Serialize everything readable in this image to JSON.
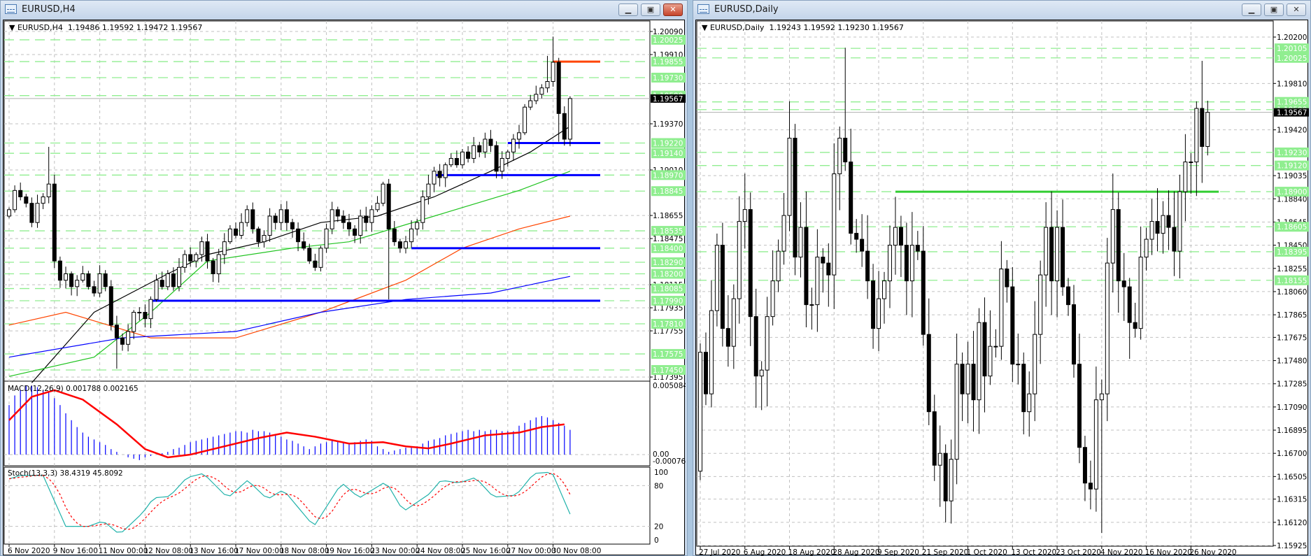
{
  "colors": {
    "bull": "#ffffff",
    "bear": "#000000",
    "grid": "#c0c0c0",
    "level": "#90ee90",
    "ma_black": "#000000",
    "ma_green": "#1fc31f",
    "ma_red": "#ff4500",
    "ma_blue": "#0000ff",
    "hline_red": "#ff4500",
    "hline_blue": "#0000ff",
    "hline_green": "#32cd32",
    "macd_hist": "#0000ff",
    "macd_signal": "#ff0000",
    "stoch_main": "#20b2aa",
    "stoch_signal": "#ff0000"
  },
  "windows": [
    {
      "title": "EURUSD,H4",
      "symbol": "EURUSD,H4",
      "ohlc": "1.19486 1.19592 1.19472 1.19567",
      "buttons": {
        "minimize": "▁",
        "restore": "▣",
        "close": "✕"
      }
    },
    {
      "title": "EURUSD,Daily",
      "symbol": "EURUSD,Daily",
      "ohlc": "1.19243 1.19592 1.19230 1.19567",
      "buttons": {
        "minimize": "▁",
        "restore": "▣",
        "close": "✕"
      }
    }
  ],
  "h4": {
    "current_price": "1.19567",
    "price_ticks": [
      "1.20090",
      "1.19910",
      "1.19370",
      "1.19010",
      "1.18655",
      "1.18475",
      "1.18115",
      "1.17935",
      "1.17755",
      "1.17395"
    ],
    "levels": [
      "1.20025",
      "1.19855",
      "1.19730",
      "1.19590",
      "1.19220",
      "1.19140",
      "1.18970",
      "1.18845",
      "1.18535",
      "1.18400",
      "1.18290",
      "1.18200",
      "1.18085",
      "1.17990",
      "1.17810",
      "1.17575",
      "1.17450"
    ],
    "time_labels": [
      "6 Nov 2020",
      "9 Nov 16:00",
      "11 Nov 00:00",
      "12 Nov 08:00",
      "13 Nov 16:00",
      "17 Nov 00:00",
      "18 Nov 08:00",
      "19 Nov 16:00",
      "23 Nov 00:00",
      "24 Nov 08:00",
      "25 Nov 16:00",
      "27 Nov 00:00",
      "30 Nov 08:00"
    ],
    "open0": 1.1865,
    "closes": [
      1.187,
      1.1885,
      1.188,
      1.1875,
      1.186,
      1.1875,
      1.188,
      1.189,
      1.183,
      1.1815,
      1.182,
      1.181,
      1.1815,
      1.182,
      1.181,
      1.1805,
      1.182,
      1.181,
      1.178,
      1.177,
      1.1765,
      1.1775,
      1.179,
      1.179,
      1.1785,
      1.18,
      1.1815,
      1.181,
      1.182,
      1.181,
      1.1825,
      1.1835,
      1.183,
      1.1835,
      1.1845,
      1.183,
      1.182,
      1.1835,
      1.1845,
      1.1855,
      1.185,
      1.186,
      1.187,
      1.1855,
      1.1845,
      1.185,
      1.1865,
      1.186,
      1.187,
      1.186,
      1.1855,
      1.1845,
      1.184,
      1.183,
      1.1825,
      1.184,
      1.1855,
      1.187,
      1.1865,
      1.186,
      1.1855,
      1.185,
      1.1865,
      1.186,
      1.187,
      1.1875,
      1.189,
      1.1855,
      1.1845,
      1.184,
      1.1845,
      1.1855,
      1.186,
      1.188,
      1.189,
      1.19,
      1.1895,
      1.1905,
      1.191,
      1.1905,
      1.1915,
      1.191,
      1.192,
      1.1915,
      1.1925,
      1.192,
      1.19,
      1.191,
      1.1915,
      1.1925,
      1.193,
      1.195,
      1.1955,
      1.196,
      1.1965,
      1.197,
      1.1985,
      1.1945,
      1.1925,
      1.19567
    ],
    "high_overrides": {
      "7": 1.1919,
      "96": 1.2005,
      "95": 1.199
    },
    "low_overrides": {
      "19": 1.1746,
      "67": 1.18,
      "97": 1.1923
    },
    "ma": {
      "black": [
        [
          4,
          1.1735
        ],
        [
          15,
          1.179
        ],
        [
          28,
          1.182
        ],
        [
          35,
          1.1835
        ],
        [
          45,
          1.1845
        ],
        [
          55,
          1.186
        ],
        [
          65,
          1.1865
        ],
        [
          75,
          1.188
        ],
        [
          85,
          1.19
        ],
        [
          92,
          1.1915
        ],
        [
          99,
          1.1935
        ]
      ],
      "green": [
        [
          0,
          1.174
        ],
        [
          15,
          1.1755
        ],
        [
          25,
          1.179
        ],
        [
          35,
          1.183
        ],
        [
          50,
          1.184
        ],
        [
          60,
          1.1845
        ],
        [
          75,
          1.1865
        ],
        [
          90,
          1.1885
        ],
        [
          99,
          1.19
        ]
      ],
      "red": [
        [
          0,
          1.178
        ],
        [
          10,
          1.179
        ],
        [
          25,
          1.177
        ],
        [
          40,
          1.177
        ],
        [
          55,
          1.179
        ],
        [
          70,
          1.1815
        ],
        [
          80,
          1.184
        ],
        [
          90,
          1.1855
        ],
        [
          99,
          1.1865
        ]
      ],
      "blue": [
        [
          0,
          1.1755
        ],
        [
          20,
          1.177
        ],
        [
          40,
          1.1775
        ],
        [
          55,
          1.179
        ],
        [
          70,
          1.18
        ],
        [
          85,
          1.1805
        ],
        [
          99,
          1.1818
        ]
      ]
    },
    "hlines": [
      {
        "color": "hline_red",
        "price": 1.19855,
        "from": 96
      },
      {
        "color": "hline_blue",
        "price": 1.1922,
        "from": 88
      },
      {
        "color": "hline_blue",
        "price": 1.1897,
        "from": 75
      },
      {
        "color": "hline_blue",
        "price": 1.184,
        "from": 71
      },
      {
        "color": "hline_blue",
        "price": 1.1799,
        "from": 25
      }
    ],
    "macd": {
      "label": "MACD(12,26,9) 0.001788 0.002165",
      "max_label": "0.005084",
      "zero_label": "0.00",
      "min_label": "-0.00076",
      "main": [
        0.0036,
        0.0043,
        0.0047,
        0.005,
        0.005,
        0.0049,
        0.0047,
        0.0045,
        0.0041,
        0.0036,
        0.003,
        0.0025,
        0.002,
        0.0016,
        0.0013,
        0.0011,
        0.0009,
        0.0007,
        0.0004,
        0.0002,
        0.0,
        -0.0002,
        -0.0003,
        -0.0004,
        -0.0002,
        -0.0001,
        0.0,
        0.0001,
        0.0002,
        0.0004,
        0.0005,
        0.0007,
        0.0009,
        0.001,
        0.0011,
        0.0012,
        0.0013,
        0.0014,
        0.0015,
        0.0016,
        0.0017,
        0.0017,
        0.0016,
        0.0018,
        0.0017,
        0.0017,
        0.0016,
        0.0015,
        0.0013,
        0.0011,
        0.001,
        0.0008,
        0.0006,
        0.0004,
        0.0006,
        0.0008,
        0.0009,
        0.001,
        0.001,
        0.0009,
        0.0008,
        0.0009,
        0.001,
        0.0011,
        0.001,
        0.0006,
        0.0004,
        0.0002,
        0.0003,
        0.0004,
        0.0005,
        0.0005,
        0.0006,
        0.0008,
        0.001,
        0.0011,
        0.0012,
        0.0014,
        0.0015,
        0.0016,
        0.0017,
        0.0018,
        0.0017,
        0.0018,
        0.0017,
        0.0018,
        0.0018,
        0.0017,
        0.0017,
        0.0017,
        0.0021,
        0.0023,
        0.0025,
        0.0027,
        0.0028,
        0.0027,
        0.0025,
        0.0023,
        0.0021,
        0.0018
      ],
      "signal": [
        [
          0,
          0.0025
        ],
        [
          4,
          0.0042
        ],
        [
          8,
          0.00468
        ],
        [
          13,
          0.004
        ],
        [
          19,
          0.0022
        ],
        [
          24,
          0.0004
        ],
        [
          28,
          -0.0002
        ],
        [
          32,
          0.0
        ],
        [
          38,
          0.0006
        ],
        [
          44,
          0.0012
        ],
        [
          49,
          0.0016
        ],
        [
          54,
          0.0013
        ],
        [
          60,
          0.0008
        ],
        [
          66,
          0.0009
        ],
        [
          70,
          0.0006
        ],
        [
          74,
          0.00045
        ],
        [
          78,
          0.0008
        ],
        [
          84,
          0.0014
        ],
        [
          90,
          0.0016
        ],
        [
          94,
          0.002
        ],
        [
          98,
          0.0022
        ]
      ]
    },
    "stoch": {
      "label": "Stoch(13,3,3) 38.4319 45.8092",
      "scale_labels": [
        "100",
        "80",
        "20",
        "0"
      ],
      "k": [
        [
          0,
          90
        ],
        [
          2,
          95
        ],
        [
          6,
          95
        ],
        [
          10,
          20
        ],
        [
          14,
          20
        ],
        [
          16.6,
          28
        ],
        [
          19.5,
          8
        ],
        [
          23.6,
          40
        ],
        [
          25.5,
          62
        ],
        [
          28.3,
          64
        ],
        [
          31.4,
          92
        ],
        [
          34.3,
          98
        ],
        [
          38.6,
          62
        ],
        [
          42.1,
          88
        ],
        [
          45.6,
          60
        ],
        [
          48.4,
          74
        ],
        [
          53.8,
          20
        ],
        [
          58.7,
          84
        ],
        [
          61.8,
          62
        ],
        [
          66.5,
          86
        ],
        [
          69.6,
          42
        ],
        [
          74.2,
          68
        ],
        [
          76.2,
          88
        ],
        [
          79.4,
          84
        ],
        [
          82.3,
          92
        ],
        [
          85.5,
          63
        ],
        [
          89.5,
          66
        ],
        [
          92.6,
          98
        ],
        [
          95.8,
          100
        ],
        [
          99,
          38
        ]
      ]
    }
  },
  "daily": {
    "current_price": "1.19567",
    "price_ticks": [
      "1.20200",
      "1.19810",
      "1.19420",
      "1.19035",
      "1.18840",
      "1.18645",
      "1.18450",
      "1.18255",
      "1.18060",
      "1.17865",
      "1.17675",
      "1.17480",
      "1.17285",
      "1.17090",
      "1.16895",
      "1.16700",
      "1.16505",
      "1.16315",
      "1.16120",
      "1.15925"
    ],
    "levels": [
      "1.20105",
      "1.20025",
      "1.19655",
      "1.19590",
      "1.19230",
      "1.19120",
      "1.18900",
      "1.18605",
      "1.18395",
      "1.18155"
    ],
    "time_labels": [
      "27 Jul 2020",
      "6 Aug 2020",
      "18 Aug 2020",
      "28 Aug 2020",
      "9 Sep 2020",
      "21 Sep 2020",
      "1 Oct 2020",
      "13 Oct 2020",
      "23 Oct 2020",
      "4 Nov 2020",
      "16 Nov 2020",
      "26 Nov 2020"
    ],
    "open0": 1.1655,
    "closes": [
      1.1755,
      1.172,
      1.179,
      1.1845,
      1.1775,
      1.176,
      1.18,
      1.1865,
      1.1875,
      1.1785,
      1.1735,
      1.174,
      1.1785,
      1.1815,
      1.184,
      1.187,
      1.1935,
      1.1835,
      1.186,
      1.1795,
      1.1795,
      1.1835,
      1.183,
      1.182,
      1.1905,
      1.1935,
      1.1915,
      1.1855,
      1.185,
      1.184,
      1.1815,
      1.1775,
      1.18,
      1.1815,
      1.1845,
      1.186,
      1.1845,
      1.1815,
      1.1845,
      1.184,
      1.177,
      1.1705,
      1.166,
      1.167,
      1.163,
      1.1665,
      1.1745,
      1.172,
      1.1745,
      1.1715,
      1.178,
      1.1735,
      1.176,
      1.176,
      1.1825,
      1.181,
      1.1745,
      1.1745,
      1.1705,
      1.172,
      1.177,
      1.182,
      1.186,
      1.1815,
      1.186,
      1.181,
      1.1795,
      1.1745,
      1.1675,
      1.1645,
      1.164,
      1.1715,
      1.172,
      1.183,
      1.1875,
      1.1815,
      1.181,
      1.178,
      1.1775,
      1.1835,
      1.185,
      1.1865,
      1.1855,
      1.187,
      1.186,
      1.184,
      1.189,
      1.1915,
      1.1915,
      1.196,
      1.1928,
      1.19567
    ],
    "high_overrides": {
      "16": 1.1966,
      "26": 1.2011,
      "90": 1.2,
      "89": 1.1966
    },
    "low_overrides": {
      "72": 1.1603,
      "44": 1.1612,
      "43": 1.1625
    },
    "hlines": [
      {
        "color": "hline_green",
        "price": 1.189,
        "from": 35,
        "to": 93
      }
    ]
  }
}
